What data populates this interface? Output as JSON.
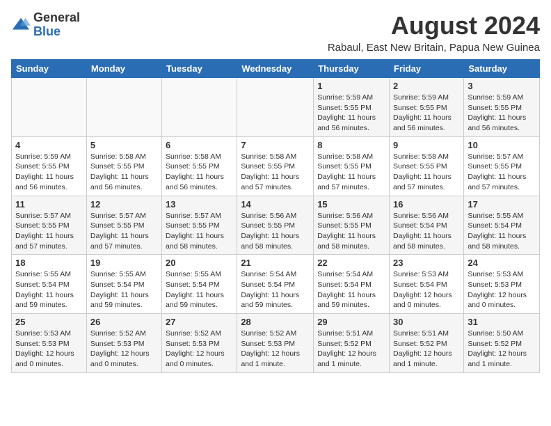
{
  "header": {
    "logo_general": "General",
    "logo_blue": "Blue",
    "month_year": "August 2024",
    "subtitle": "Rabaul, East New Britain, Papua New Guinea"
  },
  "days_of_week": [
    "Sunday",
    "Monday",
    "Tuesday",
    "Wednesday",
    "Thursday",
    "Friday",
    "Saturday"
  ],
  "weeks": [
    [
      {
        "day": "",
        "content": ""
      },
      {
        "day": "",
        "content": ""
      },
      {
        "day": "",
        "content": ""
      },
      {
        "day": "",
        "content": ""
      },
      {
        "day": "1",
        "content": "Sunrise: 5:59 AM\nSunset: 5:55 PM\nDaylight: 11 hours and 56 minutes."
      },
      {
        "day": "2",
        "content": "Sunrise: 5:59 AM\nSunset: 5:55 PM\nDaylight: 11 hours and 56 minutes."
      },
      {
        "day": "3",
        "content": "Sunrise: 5:59 AM\nSunset: 5:55 PM\nDaylight: 11 hours and 56 minutes."
      }
    ],
    [
      {
        "day": "4",
        "content": "Sunrise: 5:59 AM\nSunset: 5:55 PM\nDaylight: 11 hours and 56 minutes."
      },
      {
        "day": "5",
        "content": "Sunrise: 5:58 AM\nSunset: 5:55 PM\nDaylight: 11 hours and 56 minutes."
      },
      {
        "day": "6",
        "content": "Sunrise: 5:58 AM\nSunset: 5:55 PM\nDaylight: 11 hours and 56 minutes."
      },
      {
        "day": "7",
        "content": "Sunrise: 5:58 AM\nSunset: 5:55 PM\nDaylight: 11 hours and 57 minutes."
      },
      {
        "day": "8",
        "content": "Sunrise: 5:58 AM\nSunset: 5:55 PM\nDaylight: 11 hours and 57 minutes."
      },
      {
        "day": "9",
        "content": "Sunrise: 5:58 AM\nSunset: 5:55 PM\nDaylight: 11 hours and 57 minutes."
      },
      {
        "day": "10",
        "content": "Sunrise: 5:57 AM\nSunset: 5:55 PM\nDaylight: 11 hours and 57 minutes."
      }
    ],
    [
      {
        "day": "11",
        "content": "Sunrise: 5:57 AM\nSunset: 5:55 PM\nDaylight: 11 hours and 57 minutes."
      },
      {
        "day": "12",
        "content": "Sunrise: 5:57 AM\nSunset: 5:55 PM\nDaylight: 11 hours and 57 minutes."
      },
      {
        "day": "13",
        "content": "Sunrise: 5:57 AM\nSunset: 5:55 PM\nDaylight: 11 hours and 58 minutes."
      },
      {
        "day": "14",
        "content": "Sunrise: 5:56 AM\nSunset: 5:55 PM\nDaylight: 11 hours and 58 minutes."
      },
      {
        "day": "15",
        "content": "Sunrise: 5:56 AM\nSunset: 5:55 PM\nDaylight: 11 hours and 58 minutes."
      },
      {
        "day": "16",
        "content": "Sunrise: 5:56 AM\nSunset: 5:54 PM\nDaylight: 11 hours and 58 minutes."
      },
      {
        "day": "17",
        "content": "Sunrise: 5:55 AM\nSunset: 5:54 PM\nDaylight: 11 hours and 58 minutes."
      }
    ],
    [
      {
        "day": "18",
        "content": "Sunrise: 5:55 AM\nSunset: 5:54 PM\nDaylight: 11 hours and 59 minutes."
      },
      {
        "day": "19",
        "content": "Sunrise: 5:55 AM\nSunset: 5:54 PM\nDaylight: 11 hours and 59 minutes."
      },
      {
        "day": "20",
        "content": "Sunrise: 5:55 AM\nSunset: 5:54 PM\nDaylight: 11 hours and 59 minutes."
      },
      {
        "day": "21",
        "content": "Sunrise: 5:54 AM\nSunset: 5:54 PM\nDaylight: 11 hours and 59 minutes."
      },
      {
        "day": "22",
        "content": "Sunrise: 5:54 AM\nSunset: 5:54 PM\nDaylight: 11 hours and 59 minutes."
      },
      {
        "day": "23",
        "content": "Sunrise: 5:53 AM\nSunset: 5:54 PM\nDaylight: 12 hours and 0 minutes."
      },
      {
        "day": "24",
        "content": "Sunrise: 5:53 AM\nSunset: 5:53 PM\nDaylight: 12 hours and 0 minutes."
      }
    ],
    [
      {
        "day": "25",
        "content": "Sunrise: 5:53 AM\nSunset: 5:53 PM\nDaylight: 12 hours and 0 minutes."
      },
      {
        "day": "26",
        "content": "Sunrise: 5:52 AM\nSunset: 5:53 PM\nDaylight: 12 hours and 0 minutes."
      },
      {
        "day": "27",
        "content": "Sunrise: 5:52 AM\nSunset: 5:53 PM\nDaylight: 12 hours and 0 minutes."
      },
      {
        "day": "28",
        "content": "Sunrise: 5:52 AM\nSunset: 5:53 PM\nDaylight: 12 hours and 1 minute."
      },
      {
        "day": "29",
        "content": "Sunrise: 5:51 AM\nSunset: 5:52 PM\nDaylight: 12 hours and 1 minute."
      },
      {
        "day": "30",
        "content": "Sunrise: 5:51 AM\nSunset: 5:52 PM\nDaylight: 12 hours and 1 minute."
      },
      {
        "day": "31",
        "content": "Sunrise: 5:50 AM\nSunset: 5:52 PM\nDaylight: 12 hours and 1 minute."
      }
    ]
  ]
}
